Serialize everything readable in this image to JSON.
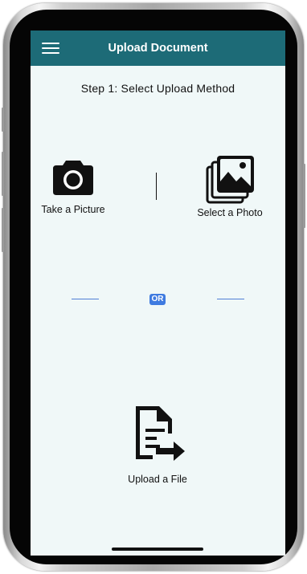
{
  "header": {
    "title": "Upload Document",
    "menu_icon": "hamburger-menu-icon",
    "background": "#1d6b77"
  },
  "step": {
    "title": "Step 1: Select Upload Method"
  },
  "options": {
    "take_picture": {
      "label": "Take a Picture",
      "icon": "camera-icon"
    },
    "select_photo": {
      "label": "Select a Photo",
      "icon": "photo-gallery-icon"
    },
    "upload_file": {
      "label": "Upload a File",
      "icon": "file-upload-icon"
    }
  },
  "separator": {
    "or_label": "OR",
    "accent": "#3f7be0"
  }
}
